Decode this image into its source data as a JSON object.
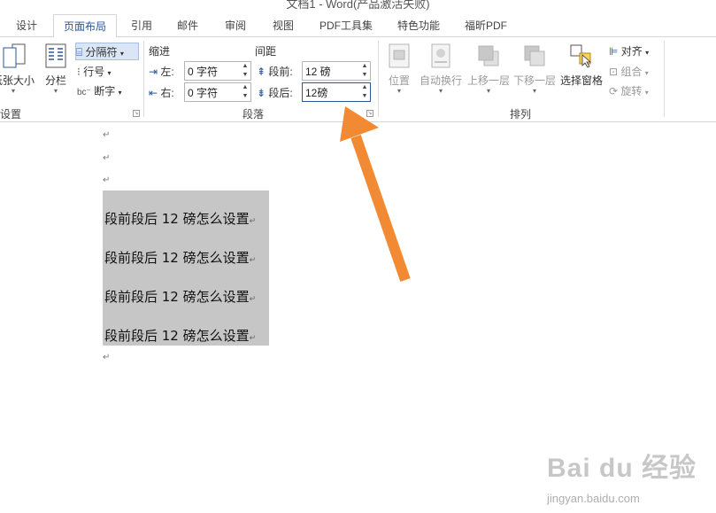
{
  "window": {
    "title": "文档1 - Word(产品激活失败)"
  },
  "tabs": [
    {
      "label": "设计",
      "active": false
    },
    {
      "label": "页面布局",
      "active": true
    },
    {
      "label": "引用",
      "active": false
    },
    {
      "label": "邮件",
      "active": false
    },
    {
      "label": "审阅",
      "active": false
    },
    {
      "label": "视图",
      "active": false
    },
    {
      "label": "PDF工具集",
      "active": false
    },
    {
      "label": "特色功能",
      "active": false
    },
    {
      "label": "福昕PDF",
      "active": false
    }
  ],
  "page_setup": {
    "paper_size_label": "纸张大小",
    "columns_label": "分栏",
    "breaks_label": "分隔符",
    "line_numbers_label": "行号",
    "hyphenation_label": "断字",
    "group_label": "设置"
  },
  "paragraph": {
    "indent_header": "缩进",
    "spacing_header": "间距",
    "indent_left_label": "左:",
    "indent_left_value": "0 字符",
    "indent_right_label": "右:",
    "indent_right_value": "0 字符",
    "spacing_before_label": "段前:",
    "spacing_before_value": "12 磅",
    "spacing_after_label": "段后:",
    "spacing_after_value": "12磅",
    "group_label": "段落"
  },
  "arrange": {
    "position_label": "位置",
    "wrap_text_label": "自动换行",
    "bring_forward_label": "上移一层",
    "send_backward_label": "下移一层",
    "selection_pane_label": "选择窗格",
    "align_label": "对齐",
    "group_label": "组合",
    "rotate_label": "旋转",
    "group_title": "排列"
  },
  "document": {
    "lines": [
      "段前段后 12 磅怎么设置",
      "段前段后 12 磅怎么设置",
      "段前段后 12 磅怎么设置",
      "段前段后 12 磅怎么设置"
    ],
    "paragraph_mark": "↵"
  },
  "watermark": {
    "brand": "Bai du 经验",
    "url": "jingyan.baidu.com"
  },
  "colors": {
    "accent": "#2b579a",
    "selection": "#c6c6c6",
    "arrow": "#f28a33"
  }
}
